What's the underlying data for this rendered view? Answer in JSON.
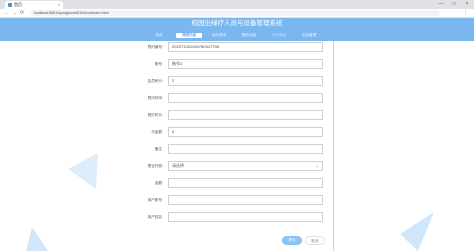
{
  "browser": {
    "tab_title": "首页",
    "tab_close": "×",
    "url": "localhost:8081/springbootrt51h/front/index.html",
    "nav": {
      "back": "←",
      "forward": "→",
      "reload": "⟳"
    },
    "window_controls": {
      "minimize": "—",
      "maximize": "□",
      "close": "×"
    },
    "menu": "⋮"
  },
  "header": {
    "title": "校园出绿疗人员与设备管理系统"
  },
  "nav_items": [
    {
      "label": "首页"
    },
    {
      "label": "健康档案",
      "active": true
    },
    {
      "label": "运动资讯"
    },
    {
      "label": "服务设施"
    },
    {
      "label": "个人中心"
    },
    {
      "label": "后台管理"
    }
  ],
  "form": {
    "rows": [
      {
        "label": "预约编号:",
        "value": "2023T1022094780317796"
      },
      {
        "label": "账号:",
        "value": "账号2"
      },
      {
        "label": "会员积分:",
        "value": "2"
      },
      {
        "label": "预约时间:",
        "value": ""
      },
      {
        "label": "预约时长:",
        "value": ""
      },
      {
        "label": "代金额:",
        "value": "0"
      },
      {
        "label": "备注:",
        "value": ""
      },
      {
        "label": "是否开放:",
        "value": "请选择",
        "select": true
      },
      {
        "label": "金额:",
        "value": ""
      },
      {
        "label": "用户账号:",
        "value": ""
      },
      {
        "label": "用户姓名:",
        "value": ""
      }
    ],
    "select_arrow": "⌄",
    "submit_label": "提交",
    "cancel_label": "取消"
  },
  "colors": {
    "header_bg": "#79b8f0",
    "accent": "#3b8ce0",
    "decor_light": "#cfe6fb"
  }
}
